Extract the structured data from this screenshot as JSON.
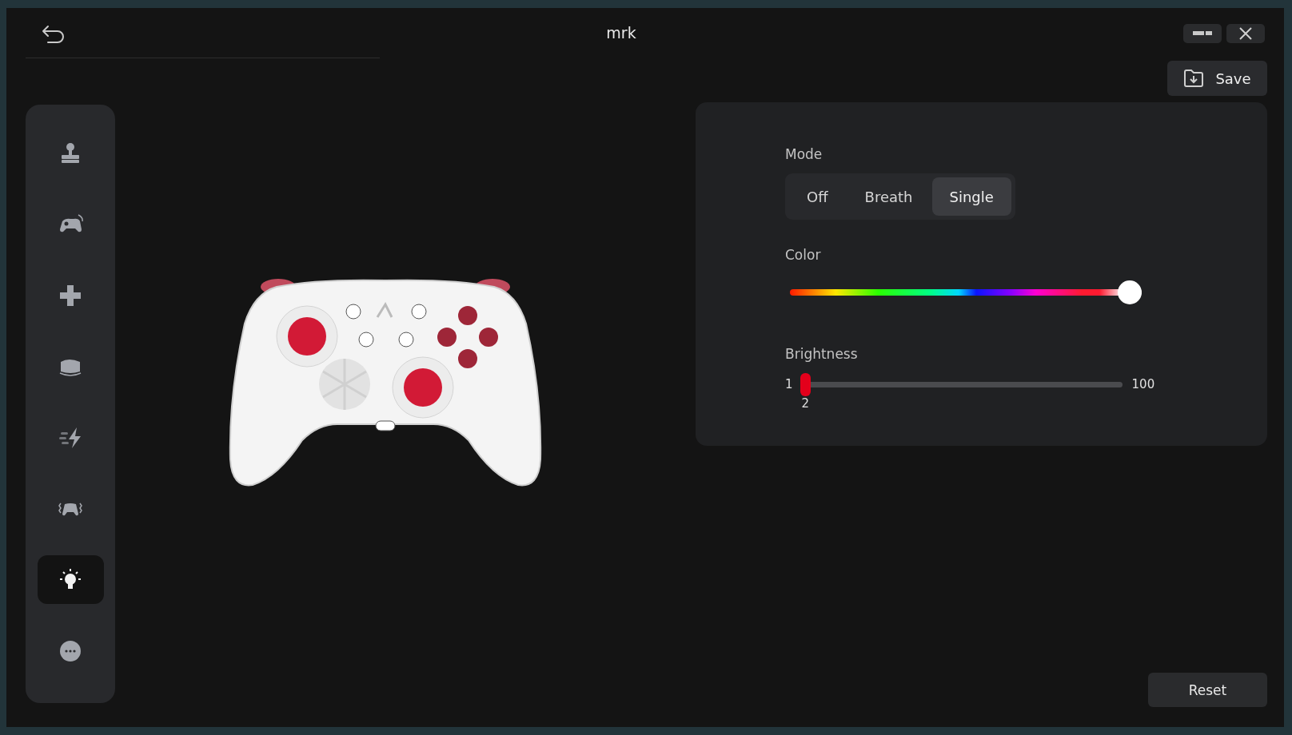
{
  "window": {
    "title": "mrk"
  },
  "sidebar": {
    "items": [
      {
        "selected": false
      },
      {
        "selected": false
      },
      {
        "selected": false
      },
      {
        "selected": false
      },
      {
        "selected": false
      },
      {
        "selected": false
      },
      {
        "selected": true
      },
      {
        "selected": false
      }
    ]
  },
  "toolbar": {
    "save": "Save"
  },
  "lighting": {
    "mode": {
      "label": "Mode",
      "options": [
        {
          "label": "Off",
          "selected": false
        },
        {
          "label": "Breath",
          "selected": false
        },
        {
          "label": "Single",
          "selected": true
        }
      ]
    },
    "color": {
      "label": "Color",
      "level": 0.965
    },
    "brightness": {
      "label": "Brightness",
      "min": "1",
      "max": "100",
      "value": "2",
      "level": 0.01
    }
  },
  "footer": {
    "reset": "Reset"
  }
}
